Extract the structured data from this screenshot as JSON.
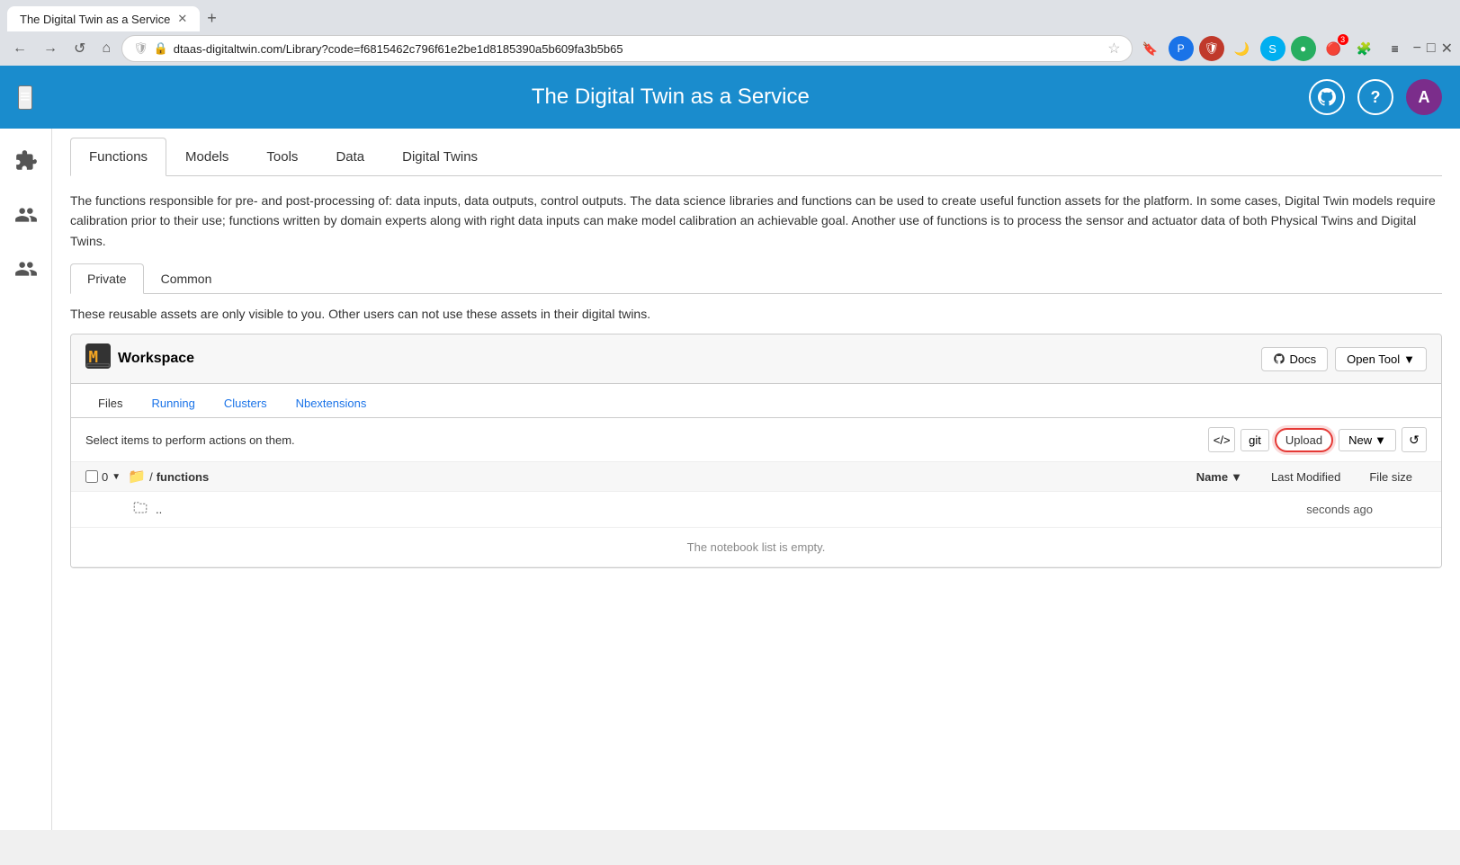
{
  "browser": {
    "tab_title": "The Digital Twin as a Service",
    "url": "dtaas-digitaltwin.com/Library?code=f6815462c796f61e2be1d8185390a5b609fa3b5b65",
    "new_tab_symbol": "+",
    "nav": {
      "back": "←",
      "forward": "→",
      "refresh": "↺",
      "home": "⌂"
    }
  },
  "app": {
    "title": "The Digital Twin as a Service",
    "hamburger": "≡",
    "github_icon": "⊙",
    "help_icon": "?",
    "avatar_letter": "A"
  },
  "sidebar": {
    "icons": [
      "puzzle",
      "people",
      "settings"
    ]
  },
  "main_tabs": [
    {
      "label": "Functions",
      "active": true
    },
    {
      "label": "Models",
      "active": false
    },
    {
      "label": "Tools",
      "active": false
    },
    {
      "label": "Data",
      "active": false
    },
    {
      "label": "Digital Twins",
      "active": false
    }
  ],
  "description": "The functions responsible for pre- and post-processing of: data inputs, data outputs, control outputs. The data science libraries and functions can be used to create useful function assets for the platform. In some cases, Digital Twin models require calibration prior to their use; functions written by domain experts along with right data inputs can make model calibration an achievable goal. Another use of functions is to process the sensor and actuator data of both Physical Twins and Digital Twins.",
  "sub_tabs": [
    {
      "label": "Private",
      "active": true
    },
    {
      "label": "Common",
      "active": false
    }
  ],
  "private_note": "These reusable assets are only visible to you. Other users can not use these assets in their digital twins.",
  "workspace": {
    "title": "Workspace",
    "docs_btn": "Docs",
    "open_tool_btn": "Open Tool",
    "jupyter_tabs": [
      {
        "label": "Files",
        "active": true
      },
      {
        "label": "Running",
        "active": false
      },
      {
        "label": "Clusters",
        "active": false
      },
      {
        "label": "Nbextensions",
        "active": false
      }
    ],
    "select_msg": "Select items to perform actions on them.",
    "toolbar": {
      "code_icon": "</>",
      "git_label": "git",
      "upload_label": "Upload",
      "new_label": "New",
      "refresh_icon": "↺"
    },
    "file_browser": {
      "checkbox_count": "0",
      "folder_icon": "📁",
      "path": "/",
      "folder_name": "functions",
      "columns": [
        {
          "label": "Name",
          "active": true,
          "sort_icon": "▼"
        },
        {
          "label": "Last Modified",
          "active": false
        },
        {
          "label": "File size",
          "active": false
        }
      ],
      "rows": [
        {
          "type": "parent",
          "icon": "folder-outline",
          "name": "..",
          "last_modified": "seconds ago",
          "file_size": ""
        }
      ],
      "empty_msg": "The notebook list is empty."
    }
  }
}
